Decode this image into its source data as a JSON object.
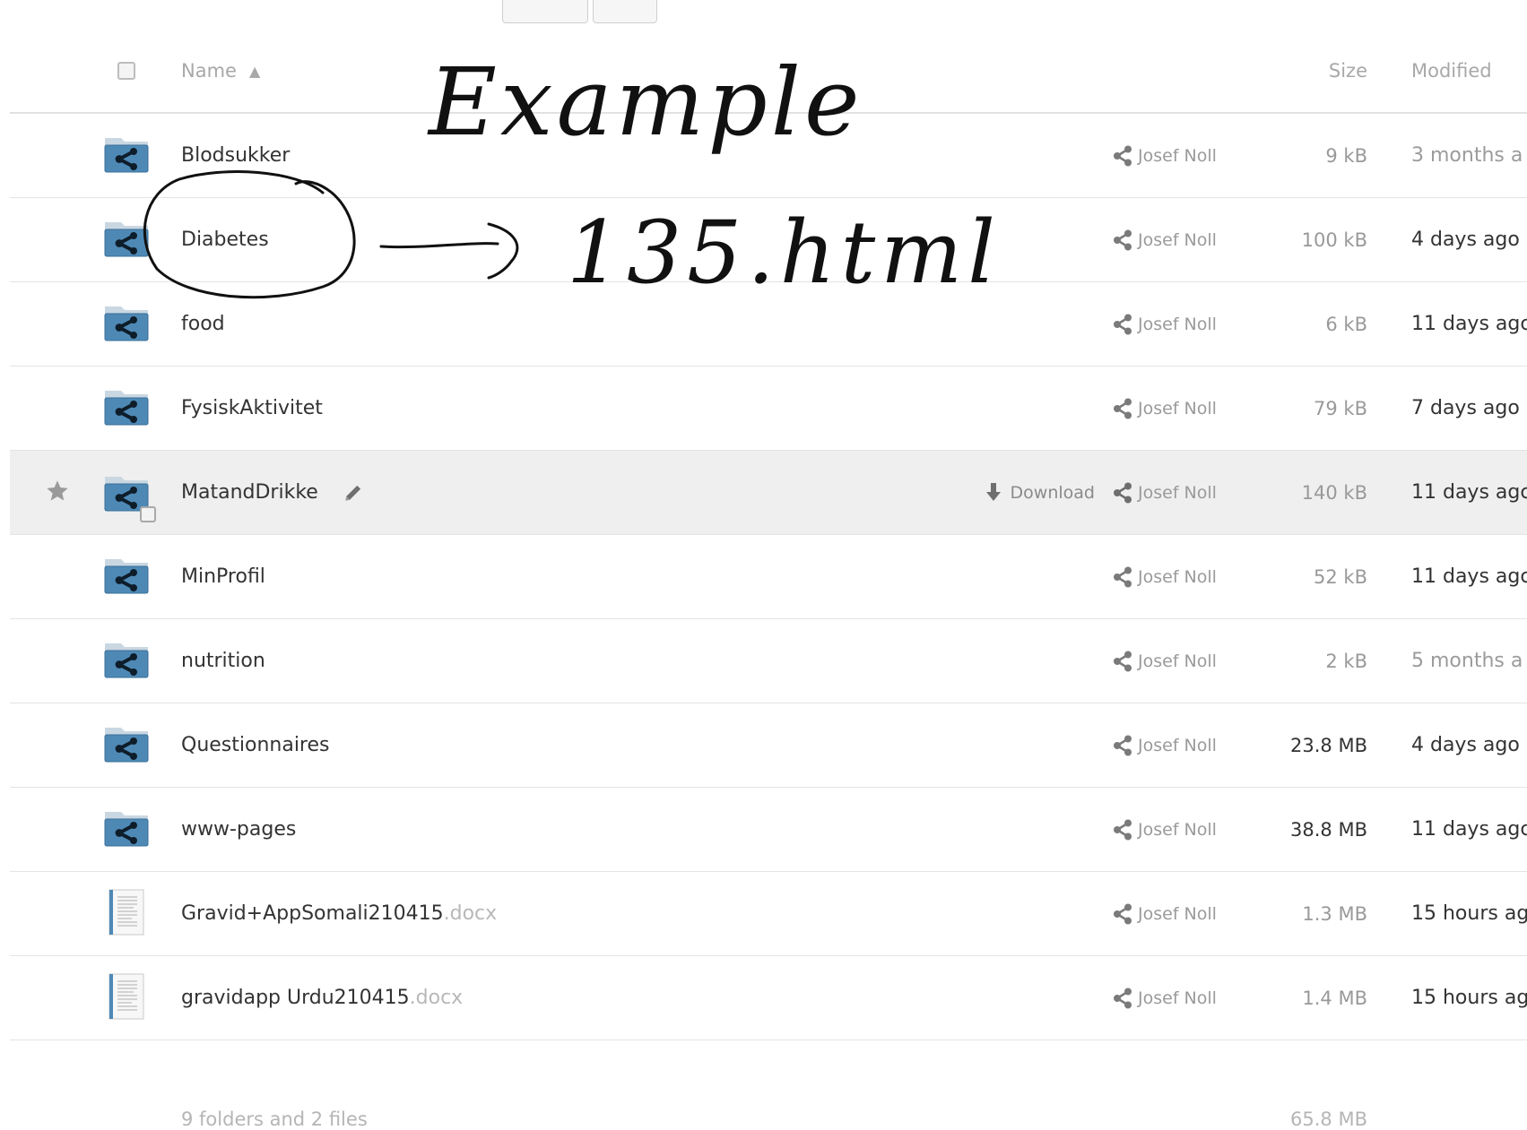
{
  "header": {
    "name_label": "Name",
    "size_label": "Size",
    "modified_label": "Modified"
  },
  "owner_name": "Josef Noll",
  "download_label": "Download",
  "rows": [
    {
      "name": "Blodsukker",
      "ext": "",
      "type": "shared-folder",
      "size": "9 kB",
      "modified": "3 months a"
    },
    {
      "name": "Diabetes",
      "ext": "",
      "type": "shared-folder",
      "size": "100 kB",
      "modified": "4 days ago"
    },
    {
      "name": "food",
      "ext": "",
      "type": "shared-folder",
      "size": "6 kB",
      "modified": "11 days agc"
    },
    {
      "name": "FysiskAktivitet",
      "ext": "",
      "type": "shared-folder",
      "size": "79 kB",
      "modified": "7 days ago"
    },
    {
      "name": "MatandDrikke",
      "ext": "",
      "type": "shared-folder",
      "size": "140 kB",
      "modified": "11 days agc"
    },
    {
      "name": "MinProfil",
      "ext": "",
      "type": "shared-folder",
      "size": "52 kB",
      "modified": "11 days agc"
    },
    {
      "name": "nutrition",
      "ext": "",
      "type": "shared-folder",
      "size": "2 kB",
      "modified": "5 months a"
    },
    {
      "name": "Questionnaires",
      "ext": "",
      "type": "shared-folder",
      "size": "23.8 MB",
      "modified": "4 days ago"
    },
    {
      "name": "www-pages",
      "ext": "",
      "type": "shared-folder",
      "size": "38.8 MB",
      "modified": "11 days agc"
    },
    {
      "name": "Gravid+AppSomali210415",
      "ext": ".docx",
      "type": "document",
      "size": "1.3 MB",
      "modified": "15 hours ag"
    },
    {
      "name": "gravidapp Urdu210415",
      "ext": ".docx",
      "type": "document",
      "size": "1.4 MB",
      "modified": "15 hours ag"
    }
  ],
  "summary": {
    "label": "9 folders and 2 files",
    "total_size": "65.8 MB"
  },
  "annotation": {
    "title": "Example",
    "target": "135.html"
  },
  "colors": {
    "folder": "#4e89b6",
    "highlight_row": "#efefef",
    "ink": "#111111"
  }
}
